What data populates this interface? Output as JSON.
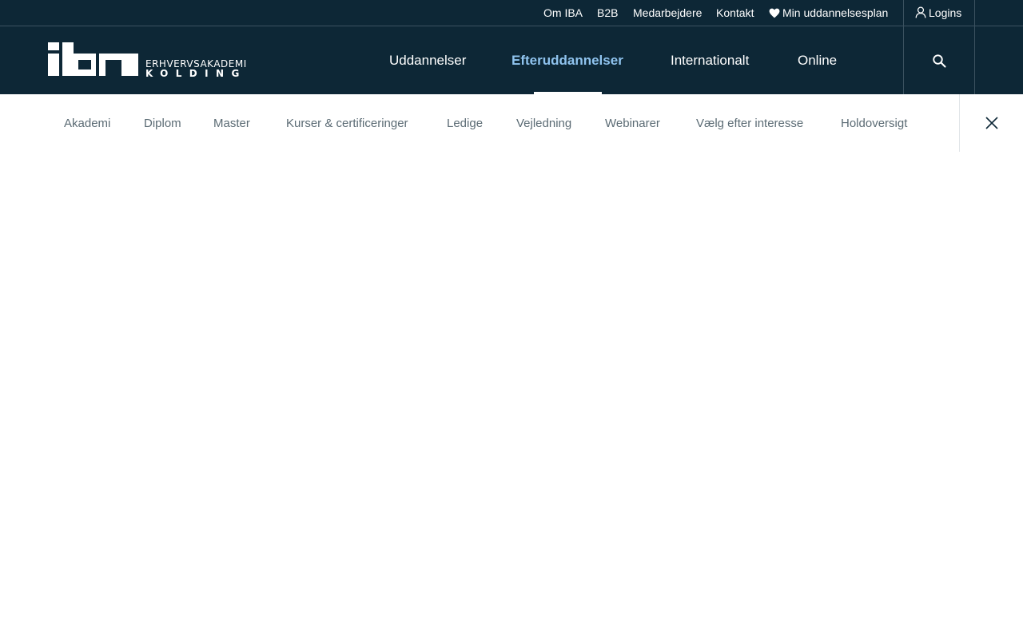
{
  "utility_nav": {
    "items": [
      {
        "label": "Om IBA"
      },
      {
        "label": "B2B"
      },
      {
        "label": "Medarbejdere"
      },
      {
        "label": "Kontakt"
      },
      {
        "label": "Min uddannelsesplan",
        "icon": "heart-icon"
      }
    ],
    "logins": {
      "label": "Logins",
      "icon": "user-icon"
    }
  },
  "logo": {
    "mark": "iba",
    "line1": "ERHVERVSAKADEMI",
    "line2": "KOLDING"
  },
  "main_nav": {
    "items": [
      {
        "label": "Uddannelser"
      },
      {
        "label": "Efteruddannelser",
        "active": true
      },
      {
        "label": "Internationalt"
      },
      {
        "label": "Online"
      }
    ],
    "search_icon": "search-icon"
  },
  "sub_nav": {
    "items": [
      {
        "label": "Akademi"
      },
      {
        "label": "Diplom"
      },
      {
        "label": "Master"
      },
      {
        "label": "Kurser & certificeringer"
      },
      {
        "label": "Ledige"
      },
      {
        "label": "Vejledning"
      },
      {
        "label": "Webinarer"
      },
      {
        "label": "Vælg efter interesse"
      },
      {
        "label": "Holdoversigt"
      }
    ],
    "close_icon": "close-icon"
  },
  "colors": {
    "header_bg": "#0d2736",
    "active_nav": "#8fc3ee",
    "sub_nav_text": "#5b6b74"
  }
}
